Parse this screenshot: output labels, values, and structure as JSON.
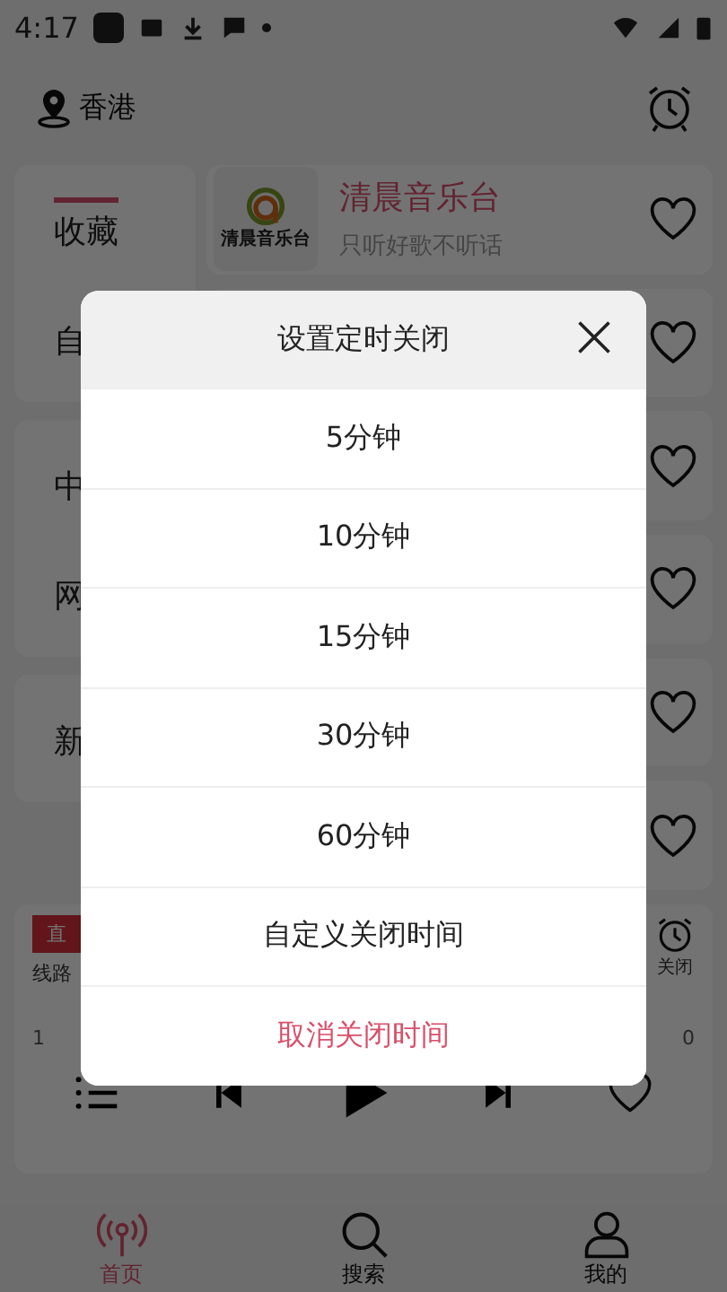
{
  "status_bar": {
    "time": "4:17"
  },
  "header": {
    "location": "香港"
  },
  "sidebar": {
    "groups": [
      {
        "items": [
          {
            "label": "收藏",
            "selected": true
          },
          {
            "label": "自"
          }
        ]
      },
      {
        "items": [
          {
            "label": "中"
          },
          {
            "label": "网"
          }
        ]
      },
      {
        "items": [
          {
            "label": "新"
          }
        ]
      }
    ]
  },
  "stations": [
    {
      "name": "清晨音乐台",
      "slogan": "只听好歌不听话",
      "logo_text": "清晨音乐台",
      "favorite": false
    },
    {
      "favorite": false
    },
    {
      "favorite": false
    },
    {
      "favorite": false
    },
    {
      "favorite": false
    },
    {
      "favorite": false
    }
  ],
  "player": {
    "badge": "直",
    "line": "线路",
    "timer_label": "关闭",
    "time_start": "1",
    "time_end": "0"
  },
  "nav": [
    {
      "label": "首页",
      "kind": "radio",
      "selected": true
    },
    {
      "label": "搜索",
      "kind": "search",
      "selected": false
    },
    {
      "label": "我的",
      "kind": "user",
      "selected": false
    }
  ],
  "dialog": {
    "title": "设置定时关闭",
    "options": [
      {
        "label": "5分钟",
        "kind": "normal"
      },
      {
        "label": "10分钟",
        "kind": "normal"
      },
      {
        "label": "15分钟",
        "kind": "normal"
      },
      {
        "label": "30分钟",
        "kind": "normal"
      },
      {
        "label": "60分钟",
        "kind": "normal"
      },
      {
        "label": "自定义关闭时间",
        "kind": "normal"
      },
      {
        "label": "取消关闭时间",
        "kind": "danger"
      }
    ]
  }
}
